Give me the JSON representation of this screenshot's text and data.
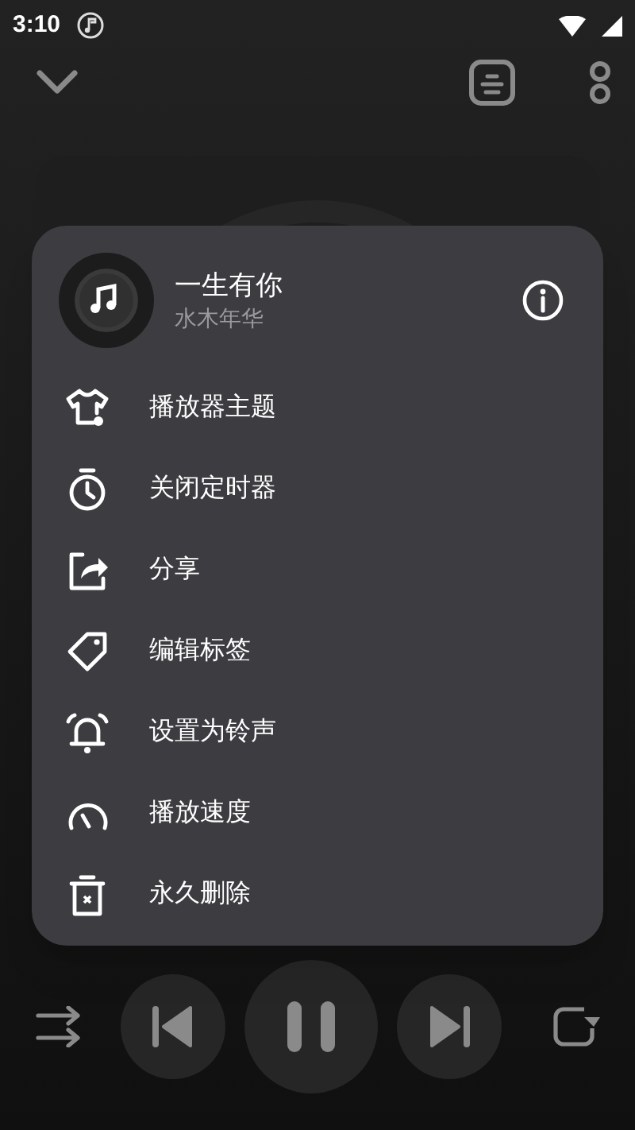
{
  "status_bar": {
    "time": "3:10"
  },
  "song": {
    "title": "一生有你",
    "artist": "水木年华"
  },
  "menu_items": [
    {
      "kind": "theme",
      "label": "播放器主题"
    },
    {
      "kind": "timer",
      "label": "关闭定时器"
    },
    {
      "kind": "share",
      "label": "分享"
    },
    {
      "kind": "tag",
      "label": "编辑标签"
    },
    {
      "kind": "ringtone",
      "label": "设置为铃声"
    },
    {
      "kind": "speed",
      "label": "播放速度"
    },
    {
      "kind": "delete",
      "label": "永久删除"
    }
  ]
}
